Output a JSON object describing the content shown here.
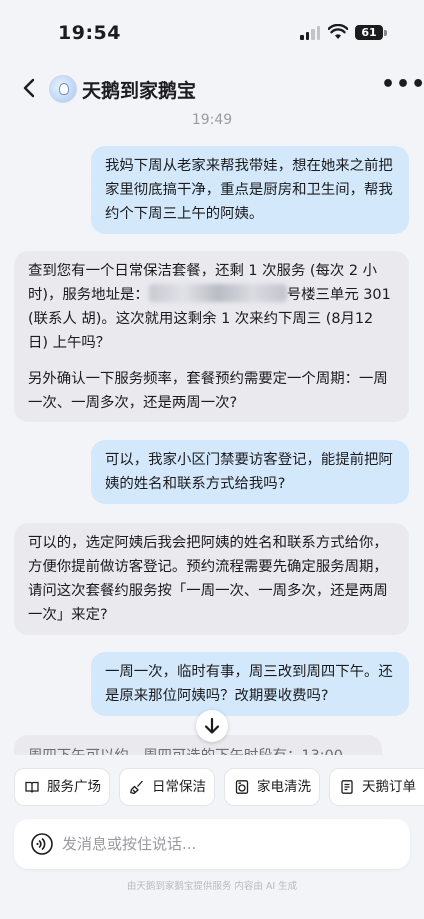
{
  "status": {
    "time": "19:54",
    "battery": "61"
  },
  "header": {
    "title": "天鹅到家鹅宝"
  },
  "chat": {
    "timestamp": "19:49",
    "messages": [
      {
        "role": "user",
        "lines": [
          "我妈下周从老家来帮我带娃，想在她来之前把",
          "家里彻底搞干净，重点是厨房和卫生间，帮我",
          "约个下周三上午的阿姨。"
        ]
      },
      {
        "role": "bot",
        "l1": "查到您有一个日常保洁套餐，还剩 1 次服务 (每次 2 小",
        "l2a": "时)，服务地址是：",
        "l2b": "号楼三单元 301",
        "l3": "(联系人 胡)。这次就用这剩余 1 次来约下周三 (8月12",
        "l4": "日) 上午吗？",
        "p2": [
          "另外确认一下服务频率，套餐预约需要定一个周期：一周",
          "一次、一周多次，还是两周一次?"
        ]
      },
      {
        "role": "user",
        "lines": [
          "可以，我家小区门禁要访客登记，能提前把阿",
          "姨的姓名和联系方式给我吗?"
        ]
      },
      {
        "role": "bot",
        "lines": [
          "可以的，选定阿姨后我会把阿姨的姓名和联系方式给你，",
          "方便你提前做访客登记。预约流程需要先确定服务周期，",
          "请问这次套餐约服务按「一周一次、一周多次，还是两周",
          "一次」来定?"
        ]
      },
      {
        "role": "user",
        "lines": [
          "一周一次，临时有事，周三改到周四下午。还",
          "是原来那位阿姨吗？改期要收费吗?"
        ]
      }
    ],
    "partial_line": "周四下午可以约，周四可选的下午时段有：13:00"
  },
  "quick_actions": [
    {
      "label": "服务广场",
      "icon": "book-icon"
    },
    {
      "label": "日常保洁",
      "icon": "broom-icon"
    },
    {
      "label": "家电清洗",
      "icon": "washer-icon"
    },
    {
      "label": "天鹅订单",
      "icon": "order-icon"
    }
  ],
  "input": {
    "placeholder": "发消息或按住说话..."
  },
  "footer": {
    "disclaimer": "由天鹅到家鹅宝提供服务 内容由 AI 生成"
  }
}
